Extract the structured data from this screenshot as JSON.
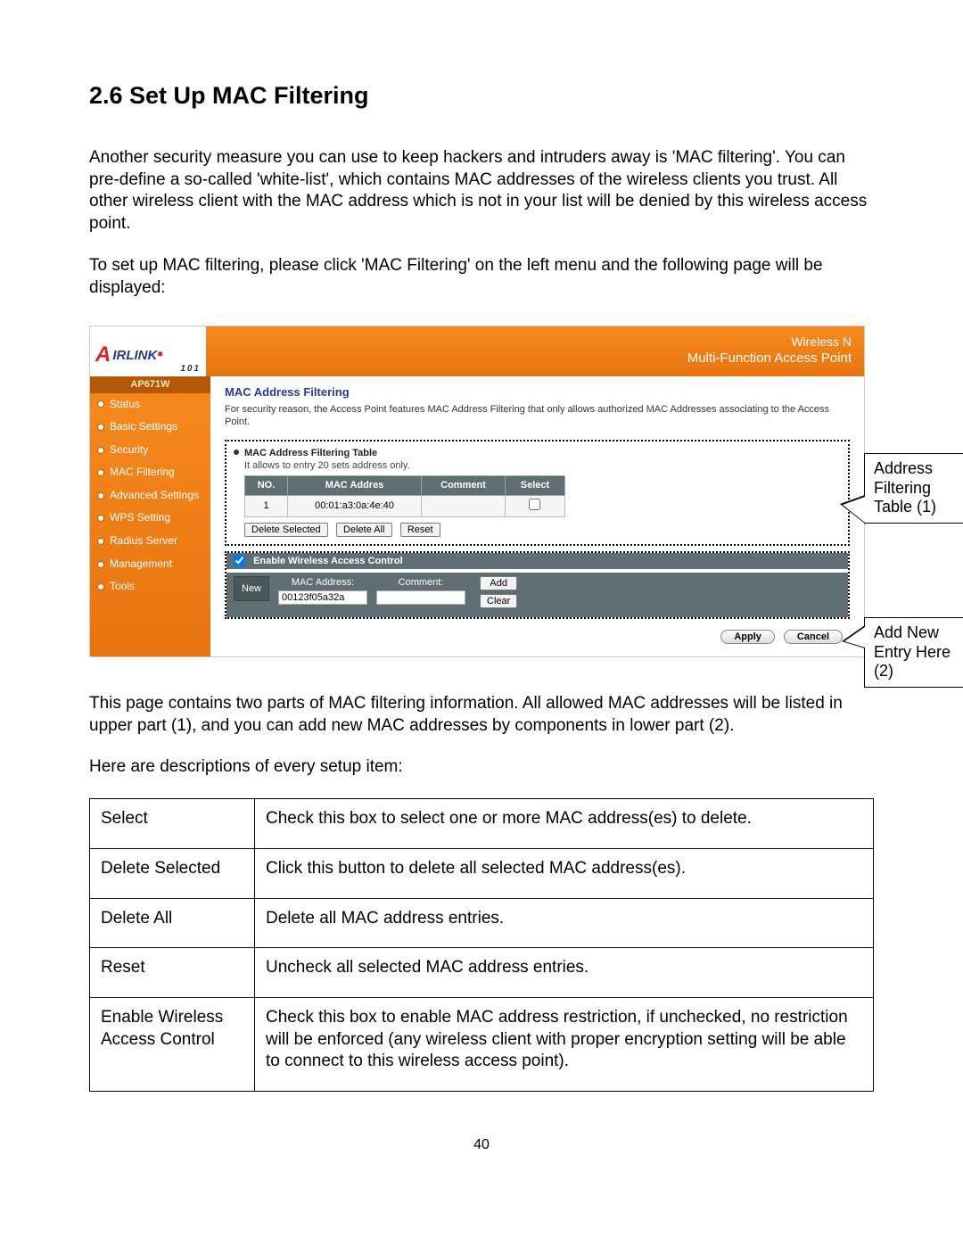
{
  "doc": {
    "heading": "2.6 Set Up MAC Filtering",
    "para1": "Another security measure you can use to keep hackers and intruders away is 'MAC filtering'. You can pre-define a so-called 'white-list', which contains MAC addresses of the wireless clients you trust. All other wireless client with the MAC address which is not in your list will be denied by this wireless access point.",
    "para2": "To set up MAC filtering, please click 'MAC Filtering' on the left menu and the following page will be displayed:",
    "para3": "This page contains two parts of MAC filtering information. All allowed MAC addresses will be listed in upper part (1), and you can add new MAC addresses by components in lower part (2).",
    "para4": "Here are descriptions of every setup item:",
    "pagenum": "40"
  },
  "router": {
    "logo_text": "IRLINK",
    "logo_sub": "101",
    "banner_line1": "Wireless N",
    "banner_line2": "Multi-Function Access Point",
    "model": "AP671W",
    "nav": [
      "Status",
      "Basic Settings",
      "Security",
      "MAC Filtering",
      "Advanced Settings",
      "WPS Setting",
      "Radius Server",
      "Management",
      "Tools"
    ],
    "main_title": "MAC Address Filtering",
    "main_desc": "For security reason, the Access Point features MAC Address Filtering that only allows authorized MAC Addresses associating to the Access Point.",
    "table_header": "MAC Address Filtering Table",
    "table_sub": "It allows to entry 20 sets address only.",
    "cols": {
      "no": "NO.",
      "mac": "MAC Addres",
      "comment": "Comment",
      "select": "Select"
    },
    "rows": [
      {
        "no": "1",
        "mac": "00:01:a3:0a:4e:40",
        "comment": "",
        "select": false
      }
    ],
    "btn_del_sel": "Delete Selected",
    "btn_del_all": "Delete All",
    "btn_reset": "Reset",
    "enable_label": "Enable Wireless Access Control",
    "new_label": "New",
    "mac_lbl": "MAC Address:",
    "mac_val": "00123f05a32a",
    "comment_lbl": "Comment:",
    "comment_val": "",
    "btn_add": "Add",
    "btn_clear": "Clear",
    "btn_apply": "Apply",
    "btn_cancel": "Cancel"
  },
  "callouts": {
    "c1": "Address Filtering Table (1)",
    "c2": "Add New Entry Here (2)"
  },
  "desc_table": [
    {
      "k": "Select",
      "v": "Check this box to select one or more MAC address(es) to delete."
    },
    {
      "k": "Delete Selected",
      "v": "Click this button to delete all selected MAC address(es)."
    },
    {
      "k": "Delete All",
      "v": "Delete all MAC address entries."
    },
    {
      "k": "Reset",
      "v": "Uncheck all selected MAC address entries."
    },
    {
      "k": "Enable Wireless Access Control",
      "v": "Check this box to enable MAC address restriction, if unchecked, no restriction will be enforced (any wireless client with proper encryption setting will be able to connect to this wireless access point)."
    }
  ]
}
